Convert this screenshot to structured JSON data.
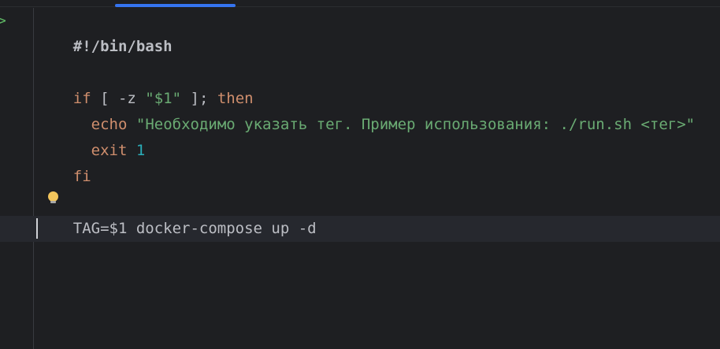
{
  "editor": {
    "lines": {
      "l1": {
        "shebang": "#!/bin/bash"
      },
      "l3": {
        "if_kw": "if",
        "cond_open": " [ -z ",
        "arg": "\"$1\"",
        "cond_close": " ]; ",
        "then_kw": "then"
      },
      "l4": {
        "indent": "  ",
        "echo_kw": "echo",
        "space": " ",
        "message": "\"Необходимо указать тег. Пример использования: ./run.sh <тег>\""
      },
      "l5": {
        "indent": "  ",
        "exit_kw": "exit",
        "space": " ",
        "code": "1"
      },
      "l6": {
        "fi_kw": "fi"
      },
      "l8": {
        "command": "TAG=$1 docker-compose up -d"
      }
    },
    "icons": {
      "run": "run-gutter-icon",
      "bulb": "lightbulb-icon"
    },
    "colors": {
      "background": "#1e1f22",
      "keyword": "#cf8e6d",
      "string": "#6aab73",
      "number": "#2aacb8",
      "text": "#bcbec4",
      "current_line": "#26282e",
      "tab_indicator": "#3574f0"
    }
  }
}
